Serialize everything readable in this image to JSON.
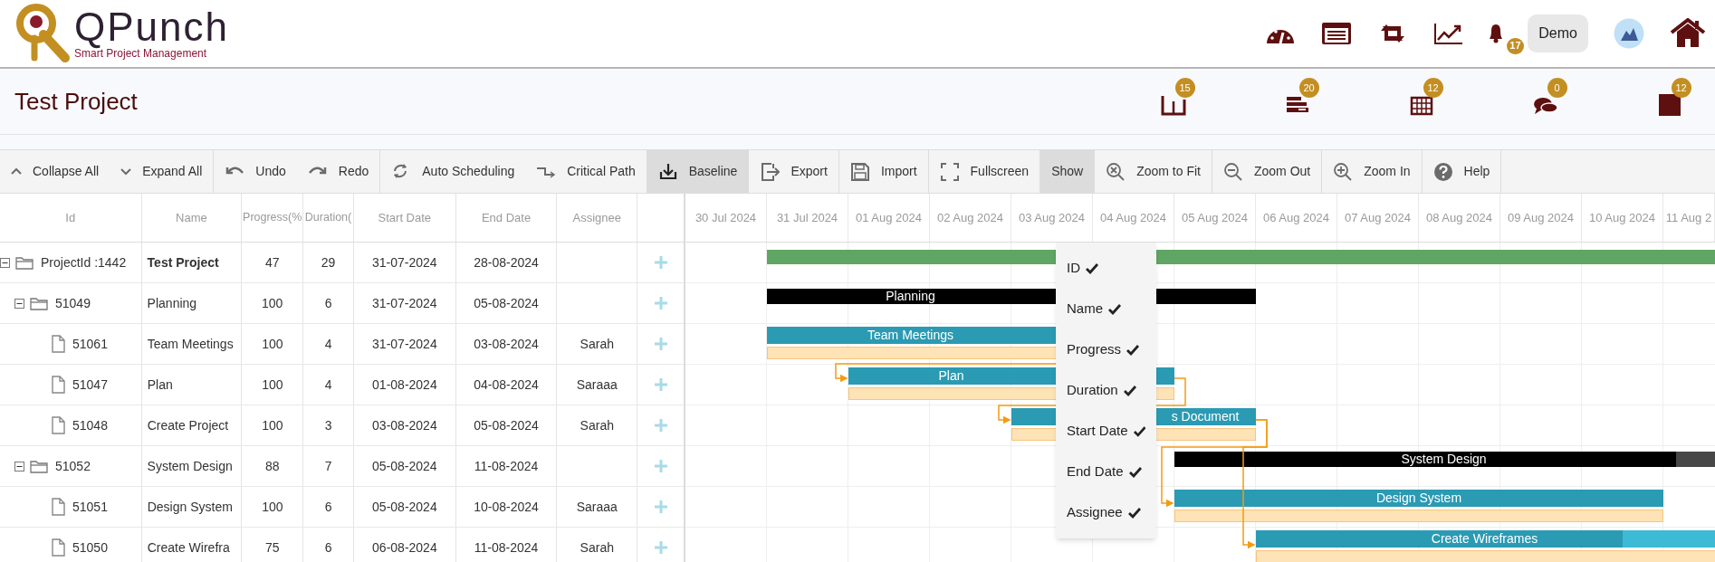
{
  "app": {
    "logo_title": "QPunch",
    "logo_subtitle": "Smart Project Management"
  },
  "nav": [
    {
      "kind": "dashboard"
    },
    {
      "kind": "list"
    },
    {
      "kind": "sync"
    },
    {
      "kind": "chart"
    },
    {
      "kind": "bell",
      "badge": "17"
    },
    {
      "kind": "user",
      "label": "Demo"
    },
    {
      "kind": "avatar"
    },
    {
      "kind": "home"
    }
  ],
  "project": {
    "title": "Test Project",
    "counters": [
      {
        "kind": "board",
        "badge": "15"
      },
      {
        "kind": "bars",
        "badge": "20"
      },
      {
        "kind": "calendar",
        "badge": "12"
      },
      {
        "kind": "chat",
        "badge": "0"
      },
      {
        "kind": "note",
        "badge": "12"
      }
    ]
  },
  "toolbar": {
    "groups": [
      {
        "items": [
          {
            "kind": "collapse",
            "label": "Collapse All",
            "active": false
          },
          {
            "kind": "expand",
            "label": "Expand All",
            "active": false
          }
        ]
      },
      {
        "items": [
          {
            "kind": "undo",
            "label": "Undo",
            "active": false
          },
          {
            "kind": "redo",
            "label": "Redo",
            "active": false
          }
        ]
      },
      {
        "items": [
          {
            "kind": "auto",
            "label": "Auto Scheduling",
            "active": false
          },
          {
            "kind": "critical",
            "label": "Critical Path",
            "active": false
          }
        ]
      },
      {
        "items": [
          {
            "kind": "baseline",
            "label": "Baseline",
            "active": true
          }
        ]
      },
      {
        "items": [
          {
            "kind": "export",
            "label": "Export",
            "active": false
          }
        ]
      },
      {
        "items": [
          {
            "kind": "import",
            "label": "Import",
            "active": false
          }
        ]
      },
      {
        "items": [
          {
            "kind": "fullscreen",
            "label": "Fullscreen",
            "active": false
          }
        ]
      },
      {
        "items": [
          {
            "kind": "show",
            "label": "Show",
            "active": true
          }
        ]
      },
      {
        "items": [
          {
            "kind": "zoomfit",
            "label": "Zoom to Fit",
            "active": false
          }
        ]
      },
      {
        "items": [
          {
            "kind": "zoomout",
            "label": "Zoom Out",
            "active": false
          }
        ]
      },
      {
        "items": [
          {
            "kind": "zoomin",
            "label": "Zoom In",
            "active": false
          }
        ]
      },
      {
        "items": [
          {
            "kind": "help",
            "label": "Help",
            "active": false
          }
        ]
      }
    ]
  },
  "table": {
    "columns": [
      "Id",
      "Name",
      "Progress(%",
      "Duration(",
      "Start Date",
      "End Date",
      "Assignee"
    ],
    "rows": [
      {
        "kind": "project",
        "id": "ProjectId :1442",
        "name": "Test Project",
        "progress": "47",
        "duration": "29",
        "start": "31-07-2024",
        "end": "28-08-2024",
        "expanded": true,
        "children": [
          {
            "kind": "summary",
            "id": "51049",
            "name": "Planning",
            "progress": "100",
            "duration": "6",
            "start": "31-07-2024",
            "end": "05-08-2024",
            "expanded": true,
            "bar_label": "Planning",
            "children": [
              {
                "kind": "task",
                "id": "51061",
                "name": "Team Meetings",
                "progress": "100",
                "duration": "4",
                "start": "31-07-2024",
                "end": "03-08-2024",
                "assignee": "Sarah",
                "bar_label": "Team Meetings"
              },
              {
                "kind": "task",
                "id": "51047",
                "name": "Plan",
                "progress": "100",
                "duration": "4",
                "start": "01-08-2024",
                "end": "04-08-2024",
                "assignee": "Saraaa",
                "bar_label": "Plan"
              },
              {
                "kind": "task",
                "id": "51048",
                "name": "Create Project",
                "progress": "100",
                "duration": "3",
                "start": "03-08-2024",
                "end": "05-08-2024",
                "assignee": "Sarah",
                "bar_label": "s Document"
              }
            ]
          },
          {
            "kind": "summary",
            "id": "51052",
            "name": "System Design",
            "progress": "88",
            "duration": "7",
            "start": "05-08-2024",
            "end": "11-08-2024",
            "expanded": true,
            "bar_label": "System Design",
            "children": [
              {
                "kind": "task",
                "id": "51051",
                "name": "Design System",
                "progress": "100",
                "duration": "6",
                "start": "05-08-2024",
                "end": "10-08-2024",
                "assignee": "Saraaa",
                "bar_label": "Design System"
              },
              {
                "kind": "task",
                "id": "51050",
                "name": "Create Wirefra",
                "progress": "75",
                "duration": "6",
                "start": "06-08-2024",
                "end": "11-08-2024",
                "assignee": "Sarah",
                "bar_label": "Create Wireframes"
              }
            ]
          }
        ]
      }
    ]
  },
  "gantt": {
    "dates": [
      "30 Jul 2024",
      "31 Jul 2024",
      "01 Aug 2024",
      "02 Aug 2024",
      "03 Aug 2024",
      "04 Aug 2024",
      "05 Aug 2024",
      "06 Aug 2024",
      "07 Aug 2024",
      "08 Aug 2024",
      "09 Aug 2024",
      "10 Aug 2024",
      "11 Aug 2"
    ]
  },
  "show_menu": {
    "items": [
      {
        "label": "ID",
        "checked": true
      },
      {
        "label": "Name",
        "checked": true
      },
      {
        "label": "Progress",
        "checked": true
      },
      {
        "label": "Duration",
        "checked": true
      },
      {
        "label": "Start Date",
        "checked": true
      },
      {
        "label": "End Date",
        "checked": true
      },
      {
        "label": "Assignee",
        "checked": true
      }
    ]
  }
}
